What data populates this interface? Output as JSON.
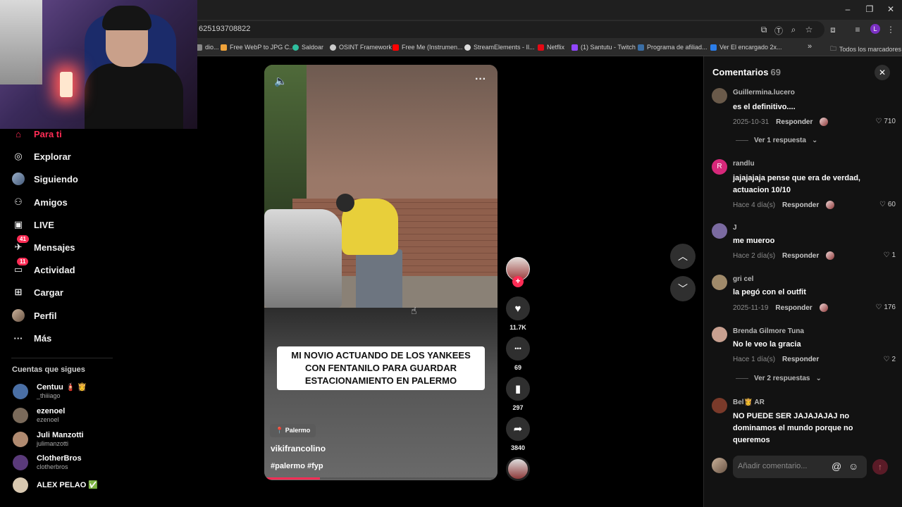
{
  "browser": {
    "url": "625193708822",
    "window_controls": [
      "–",
      "❐",
      "✕"
    ],
    "bookmarks": [
      {
        "label": "dio...",
        "color": "#888888"
      },
      {
        "label": "Free WebP to JPG C...",
        "color": "#f0a33a"
      },
      {
        "label": "Saldoar",
        "color": "#2fbf9f"
      },
      {
        "label": "OSINT Framework",
        "color": "#cccccc"
      },
      {
        "label": "Free Me (Instrumen...",
        "color": "#ff0000"
      },
      {
        "label": "StreamElements - Il...",
        "color": "#dddddd"
      },
      {
        "label": "Netflix",
        "color": "#e50914"
      },
      {
        "label": "(1) Santutu - Twitch",
        "color": "#9146ff"
      },
      {
        "label": "Programa de afiliad...",
        "color": "#3a6ea5"
      },
      {
        "label": "Ver El encargado 2x...",
        "color": "#2b7de9"
      }
    ],
    "all_bookmarks": "Todos los marcadores",
    "bookmarks_overflow": "»",
    "profile_initial": "L"
  },
  "sidebar": {
    "nav": [
      {
        "label": "Para ti",
        "icon": "home-icon",
        "glyph": "⌂",
        "active": true
      },
      {
        "label": "Explorar",
        "icon": "compass-icon",
        "glyph": "◎"
      },
      {
        "label": "Siguiendo",
        "icon": "following-avatar-icon",
        "glyph": ""
      },
      {
        "label": "Amigos",
        "icon": "friends-icon",
        "glyph": "⚇"
      },
      {
        "label": "LIVE",
        "icon": "live-icon",
        "glyph": "▣"
      },
      {
        "label": "Mensajes",
        "icon": "messages-icon",
        "glyph": "✈",
        "badge": "41"
      },
      {
        "label": "Actividad",
        "icon": "activity-icon",
        "glyph": "▭",
        "badge": "11"
      },
      {
        "label": "Cargar",
        "icon": "upload-icon",
        "glyph": "⊞"
      },
      {
        "label": "Perfil",
        "icon": "profile-avatar-icon",
        "glyph": ""
      },
      {
        "label": "Más",
        "icon": "more-icon",
        "glyph": "···"
      }
    ],
    "following_title": "Cuentas que sigues",
    "accounts": [
      {
        "name": "Centuu 🧯 👸",
        "handle": "_thiiiago",
        "color": "#4a6fa5"
      },
      {
        "name": "ezenoel",
        "handle": "ezenoel",
        "color": "#7a6a5a"
      },
      {
        "name": "Juli Manzotti",
        "handle": "julimanzotti",
        "color": "#b08a70"
      },
      {
        "name": "ClotherBros",
        "handle": "clotherbros",
        "color": "#5a3a7a"
      },
      {
        "name": "ALEX PELAO ✅",
        "handle": "",
        "color": "#d8c8b0"
      }
    ]
  },
  "video": {
    "sound_icon": "🔈",
    "more_icon": "···",
    "caption": "MI NOVIO ACTUANDO DE LOS YANKEES CON FENTANILO PARA GUARDAR ESTACIONAMIENTO EN PALERMO",
    "location": "📍 Palermo",
    "username": "vikifrancolino",
    "hashtags": "#palermo #fyp",
    "progress": 0.24
  },
  "actions": {
    "follow": "+",
    "likes": "11.7K",
    "comments": "69",
    "saves": "297",
    "shares": "3840",
    "like_glyph": "♥",
    "comment_glyph": "•••",
    "save_glyph": "▮",
    "share_glyph": "➦"
  },
  "nav_arrows": {
    "up": "︿",
    "down": "﹀"
  },
  "comments_panel": {
    "title": "Comentarios",
    "count": "69",
    "close": "✕",
    "items": [
      {
        "user": "Guillermina.lucero",
        "text": "es el definitivo....",
        "date": "2025-10-31",
        "reply": "Responder",
        "likes": "710",
        "more": "Ver 1 respuesta",
        "color": "#6a5a4a"
      },
      {
        "user": "randlu",
        "text": "jajajajaja pense que era de verdad, actuacion 10/10",
        "date": "Hace 4 día(s)",
        "reply": "Responder",
        "likes": "60",
        "color": "#d6287a",
        "initial": "R"
      },
      {
        "user": "J",
        "text": "me mueroo",
        "date": "Hace 2 día(s)",
        "reply": "Responder",
        "likes": "1",
        "color": "#7a6aa0"
      },
      {
        "user": "gri cel",
        "text": "la pegó con el outfit",
        "date": "2025-11-19",
        "reply": "Responder",
        "likes": "176",
        "color": "#a08a6a"
      },
      {
        "user": "Brenda Gilmore Tuna",
        "text": "No le veo la gracia",
        "date": "Hace 1 día(s)",
        "reply": "Responder",
        "likes": "2",
        "more": "Ver 2 respuestas",
        "color": "#c8a090"
      },
      {
        "user": "Bel👸 AR",
        "text": "NO PUEDE SER JAJAJAJAJ no dominamos el mundo porque no queremos",
        "color": "#7a3a2a"
      }
    ],
    "input_placeholder": "Añadir comentario...",
    "at_glyph": "@",
    "emoji_glyph": "☺",
    "send_glyph": "↑"
  }
}
